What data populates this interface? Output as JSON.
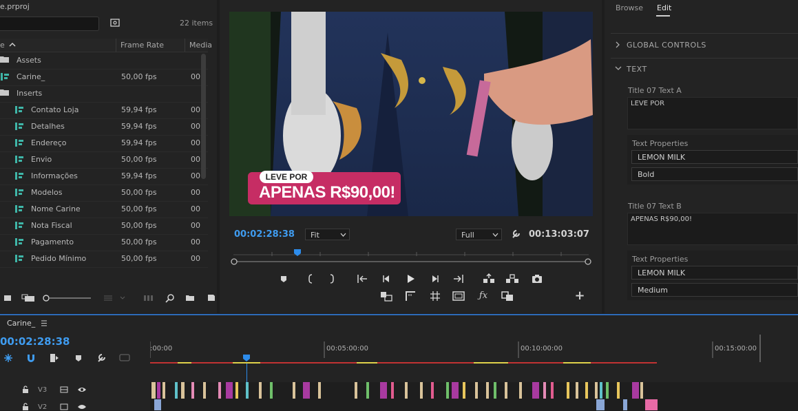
{
  "project": {
    "title": "e.prproj",
    "item_count": "22 items",
    "col_name": "e",
    "col_frame_rate": "Frame Rate",
    "col_media": "Media",
    "rows": [
      {
        "name": "Assets",
        "fps": "",
        "media": "",
        "type": "folder",
        "indent": 0
      },
      {
        "name": "Carine_",
        "fps": "50,00 fps",
        "media": "00",
        "type": "sequence",
        "indent": 0
      },
      {
        "name": "Inserts",
        "fps": "",
        "media": "",
        "type": "folder",
        "indent": 0
      },
      {
        "name": "Contato Loja",
        "fps": "59,94 fps",
        "media": "00",
        "type": "sequence",
        "indent": 1
      },
      {
        "name": "Detalhes",
        "fps": "59,94 fps",
        "media": "00",
        "type": "sequence",
        "indent": 1
      },
      {
        "name": "Endereço",
        "fps": "59,94 fps",
        "media": "00",
        "type": "sequence",
        "indent": 1
      },
      {
        "name": "Envio",
        "fps": "50,00 fps",
        "media": "00",
        "type": "sequence",
        "indent": 1
      },
      {
        "name": "Informações",
        "fps": "59,94 fps",
        "media": "00",
        "type": "sequence",
        "indent": 1
      },
      {
        "name": "Modelos",
        "fps": "50,00 fps",
        "media": "00",
        "type": "sequence",
        "indent": 1
      },
      {
        "name": "Nome Carine",
        "fps": "50,00 fps",
        "media": "00",
        "type": "sequence",
        "indent": 1
      },
      {
        "name": "Nota Fiscal",
        "fps": "50,00 fps",
        "media": "00",
        "type": "sequence",
        "indent": 1
      },
      {
        "name": "Pagamento",
        "fps": "50,00 fps",
        "media": "00",
        "type": "sequence",
        "indent": 1
      },
      {
        "name": "Pedido Mínimo",
        "fps": "50,00 fps",
        "media": "00",
        "type": "sequence",
        "indent": 1
      }
    ]
  },
  "monitor": {
    "overlay_small": "LEVE POR",
    "overlay_big": "APENAS R$90,00!",
    "current_time": "00:02:28:38",
    "fit_value": "Fit",
    "quality_value": "Full",
    "duration": "00:13:03:07"
  },
  "egp": {
    "tab_browse": "Browse",
    "tab_edit": "Edit",
    "global_controls": "GLOBAL CONTROLS",
    "text_section": "TEXT",
    "field_a_label": "Title 07 Text A",
    "field_a_value": "LEVE POR",
    "props_label_a": "Text Properties",
    "font_a": "LEMON MILK",
    "style_a": "Bold",
    "field_b_label": "Title 07 Text B",
    "field_b_value": "APENAS R$90,00!",
    "props_label_b": "Text Properties",
    "font_b": "LEMON MILK",
    "style_b": "Medium"
  },
  "timeline": {
    "tab_name": "Carine_",
    "timecode": "00:02:28:38",
    "ruler": [
      ":00:00",
      "00:05:00:00",
      "00:10:00:00",
      "00:15:00:00"
    ],
    "tracks": [
      "V3",
      "V2"
    ]
  },
  "colors": {
    "accent_blue": "#2d8ceb",
    "timecode_blue": "#3f9cf0",
    "overlay_pink": "#c62d64"
  }
}
